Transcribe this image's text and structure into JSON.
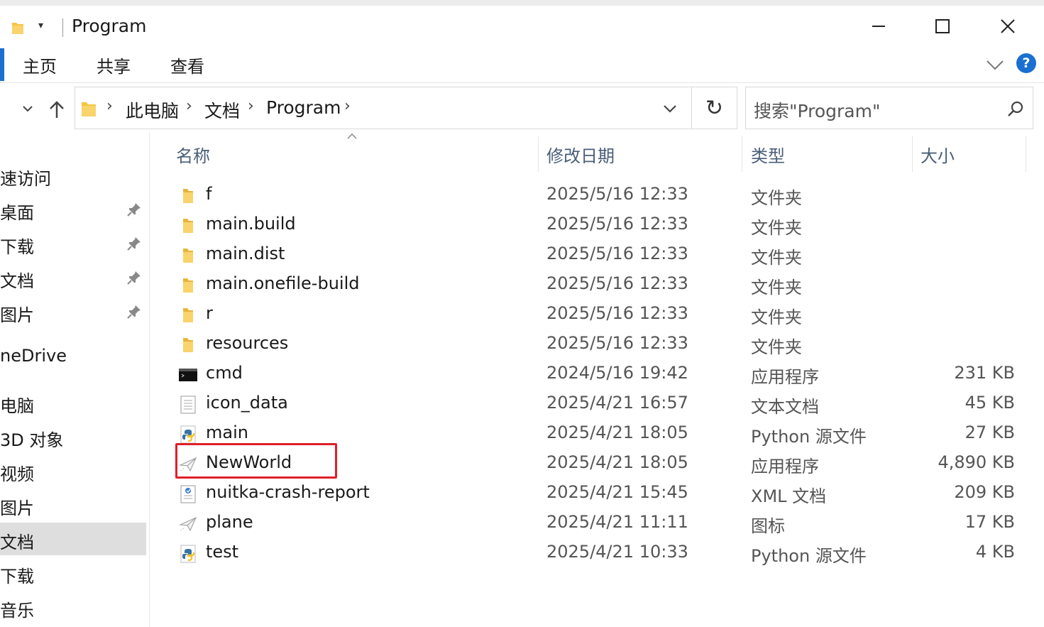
{
  "window": {
    "title": "Program",
    "quick_access_dropdown": "▾",
    "minimize": "—",
    "maximize": "☐",
    "close": "✕"
  },
  "ribbon": {
    "tabs": [
      "主页",
      "共享",
      "查看"
    ],
    "help": "?"
  },
  "address": {
    "crumbs": [
      "此电脑",
      "文档",
      "Program"
    ],
    "separator": "›",
    "refresh": "↻"
  },
  "search": {
    "placeholder": "搜索\"Program\""
  },
  "sidebar": {
    "items": [
      {
        "label": "速访问",
        "pinned": false
      },
      {
        "label": "桌面",
        "pinned": true
      },
      {
        "label": "下载",
        "pinned": true
      },
      {
        "label": "文档",
        "pinned": true
      },
      {
        "label": "图片",
        "pinned": true
      },
      {
        "label": "neDrive",
        "pinned": false
      },
      {
        "label": "电脑",
        "pinned": false
      },
      {
        "label": "3D 对象",
        "pinned": false
      },
      {
        "label": "视频",
        "pinned": false
      },
      {
        "label": "图片",
        "pinned": false
      },
      {
        "label": "文档",
        "pinned": false,
        "selected": true
      },
      {
        "label": "下载",
        "pinned": false
      },
      {
        "label": "音乐",
        "pinned": false
      }
    ]
  },
  "columns": {
    "name": "名称",
    "date": "修改日期",
    "type": "类型",
    "size": "大小"
  },
  "files": [
    {
      "name": "f",
      "date": "2025/5/16 12:33",
      "type": "文件夹",
      "size": "",
      "icon": "folder-icon"
    },
    {
      "name": "main.build",
      "date": "2025/5/16 12:33",
      "type": "文件夹",
      "size": "",
      "icon": "folder-icon"
    },
    {
      "name": "main.dist",
      "date": "2025/5/16 12:33",
      "type": "文件夹",
      "size": "",
      "icon": "folder-icon"
    },
    {
      "name": "main.onefile-build",
      "date": "2025/5/16 12:33",
      "type": "文件夹",
      "size": "",
      "icon": "folder-icon"
    },
    {
      "name": "r",
      "date": "2025/5/16 12:33",
      "type": "文件夹",
      "size": "",
      "icon": "folder-icon"
    },
    {
      "name": "resources",
      "date": "2025/5/16 12:33",
      "type": "文件夹",
      "size": "",
      "icon": "folder-icon"
    },
    {
      "name": "cmd",
      "date": "2024/5/16 19:42",
      "type": "应用程序",
      "size": "231 KB",
      "icon": "console-icon"
    },
    {
      "name": "icon_data",
      "date": "2025/4/21 16:57",
      "type": "文本文档",
      "size": "45 KB",
      "icon": "text-file-icon"
    },
    {
      "name": "main",
      "date": "2025/4/21 18:05",
      "type": "Python 源文件",
      "size": "27 KB",
      "icon": "python-file-icon"
    },
    {
      "name": "NewWorld",
      "date": "2025/4/21 18:05",
      "type": "应用程序",
      "size": "4,890 KB",
      "icon": "paper-plane-icon"
    },
    {
      "name": "nuitka-crash-report",
      "date": "2025/4/21 15:45",
      "type": "XML 文档",
      "size": "209 KB",
      "icon": "xml-file-icon"
    },
    {
      "name": "plane",
      "date": "2025/4/21 11:11",
      "type": "图标",
      "size": "17 KB",
      "icon": "paper-plane-icon"
    },
    {
      "name": "test",
      "date": "2025/4/21 10:33",
      "type": "Python 源文件",
      "size": "4 KB",
      "icon": "python-file-icon"
    }
  ],
  "highlighted_file": "NewWorld",
  "colors": {
    "accent": "#1a6fd1",
    "highlight": "#e0202a",
    "folder": "#f5c542",
    "selected_bg": "#dedede"
  }
}
